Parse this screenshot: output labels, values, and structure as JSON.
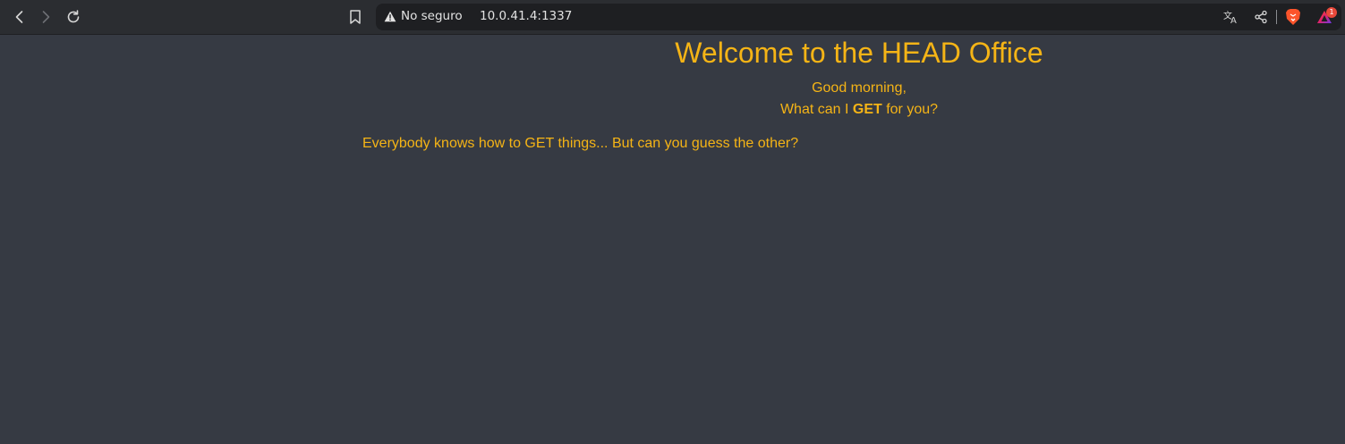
{
  "browser": {
    "security_label": "No seguro",
    "url": "10.0.41.4:1337",
    "notification_count": "1",
    "icons": {
      "back": "chevron-left-icon",
      "forward": "chevron-right-icon",
      "reload": "reload-icon",
      "bookmark": "bookmark-icon",
      "security": "warning-triangle-icon",
      "translate": "translate-icon",
      "share": "share-icon",
      "brave_shields": "brave-lion-icon",
      "brave_rewards": "brave-rewards-triangle-icon"
    }
  },
  "page": {
    "title": "Welcome to the HEAD Office",
    "greeting_line1": "Good morning,",
    "greeting_line2_prefix": "What can I ",
    "greeting_line2_bold": "GET",
    "greeting_line2_suffix": " for you?",
    "hint": "Everybody knows how to GET things... But can you guess the other?"
  },
  "colors": {
    "page_background": "#363a43",
    "text_accent": "#f5b416",
    "toolbar_background": "#2b2d31",
    "address_bar_background": "#1e1f22"
  }
}
